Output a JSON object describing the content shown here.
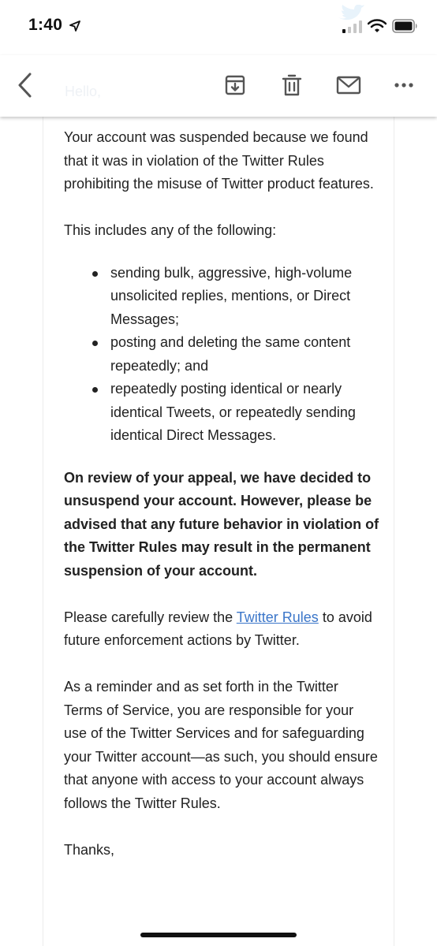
{
  "status_bar": {
    "time": "1:40",
    "icons": [
      "location-arrow-icon",
      "twitter-bird-icon",
      "signal-icon",
      "wifi-icon",
      "battery-icon"
    ]
  },
  "toolbar": {
    "hidden_greeting": "Hello,",
    "icons": [
      "back-icon",
      "archive-icon",
      "trash-icon",
      "mail-icon",
      "more-icon"
    ]
  },
  "email": {
    "paragraph1": "Your account was suspended because we found that it was in violation of the Twitter Rules prohibiting the misuse of Twitter product features.",
    "list_intro": "This includes any of the following:",
    "bullets": [
      "sending bulk, aggressive, high-volume unsolicited replies, mentions, or Direct Messages;",
      "posting and deleting the same content repeatedly; and",
      "repeatedly posting identical or nearly identical Tweets, or repeatedly sending identical Direct Messages."
    ],
    "bold_paragraph": "On review of your appeal, we have decided to unsuspend your account. However, please be advised that any future behavior in violation of the Twitter Rules may result in the permanent suspension of your account.",
    "review_prefix": "Please carefully review the ",
    "review_link": "Twitter Rules",
    "review_suffix": " to avoid future enforcement actions by Twitter.",
    "reminder": "As a reminder and as set forth in the Twitter Terms of Service, you are responsible for your use of the Twitter Services and for safeguarding your Twitter account—as such, you should ensure that anyone with access to your account always follows the Twitter Rules.",
    "sign_off": "Thanks,"
  },
  "colors": {
    "link": "#3b76c9",
    "text": "#222222",
    "icon": "#555555"
  }
}
